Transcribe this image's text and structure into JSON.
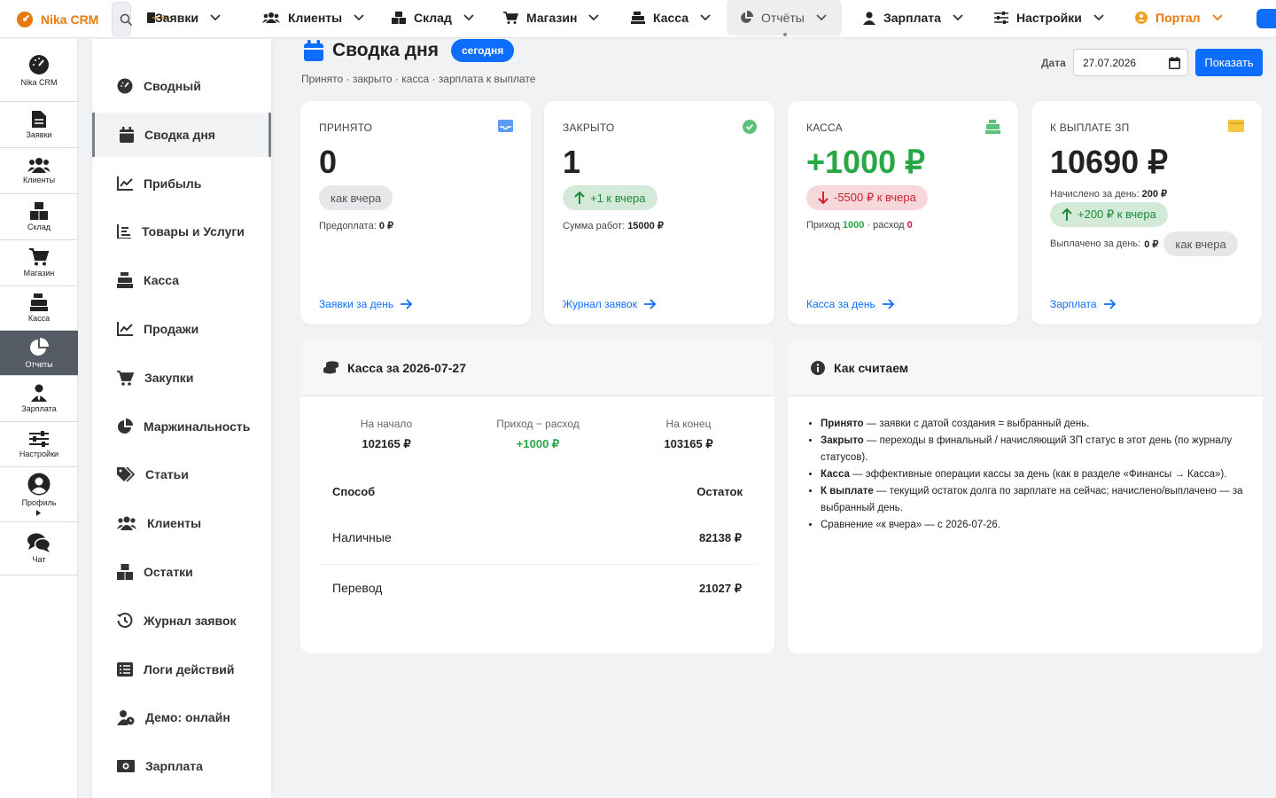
{
  "app": {
    "name": "Nika CRM"
  },
  "topnav": {
    "items": [
      {
        "label": "Заявки",
        "icon": "file-icon"
      },
      {
        "label": "Клиенты",
        "icon": "users-icon"
      },
      {
        "label": "Склад",
        "icon": "boxes-icon"
      },
      {
        "label": "Магазин",
        "icon": "cart-icon"
      },
      {
        "label": "Касса",
        "icon": "cash-register-icon"
      },
      {
        "label": "Отчёты",
        "icon": "pie-chart-icon",
        "active": true
      },
      {
        "label": "Зарплата",
        "icon": "user-icon"
      },
      {
        "label": "Настройки",
        "icon": "sliders-icon"
      },
      {
        "label": "Портал",
        "icon": "portal-icon"
      }
    ]
  },
  "rail": {
    "items": [
      {
        "label": "Nika CRM",
        "icon": "gauge-icon"
      },
      {
        "label": "Заявки",
        "icon": "file-icon"
      },
      {
        "label": "Клиенты",
        "icon": "users-icon"
      },
      {
        "label": "Склад",
        "icon": "boxes-icon"
      },
      {
        "label": "Магазин",
        "icon": "cart-icon"
      },
      {
        "label": "Касса",
        "icon": "cash-register-icon"
      },
      {
        "label": "Отчеты",
        "icon": "pie-chart-icon",
        "active": true
      },
      {
        "label": "Зарплата",
        "icon": "user-tie-icon"
      },
      {
        "label": "Настройки",
        "icon": "sliders-icon"
      },
      {
        "label": "Профиль",
        "icon": "user-circle-icon"
      },
      {
        "label": "Чат",
        "icon": "chat-icon"
      }
    ]
  },
  "submenu": {
    "items": [
      {
        "label": "Сводный",
        "icon": "gauge-icon"
      },
      {
        "label": "Сводка дня",
        "icon": "calendar-icon",
        "active": true
      },
      {
        "label": "Прибыль",
        "icon": "line-chart-icon"
      },
      {
        "label": "Товары и Услуги",
        "icon": "list-icon"
      },
      {
        "label": "Касса",
        "icon": "cash-register-icon"
      },
      {
        "label": "Продажи",
        "icon": "line-chart-icon"
      },
      {
        "label": "Закупки",
        "icon": "cart-icon"
      },
      {
        "label": "Маржинальность",
        "icon": "pie-chart-icon"
      },
      {
        "label": "Статьи",
        "icon": "tags-icon"
      },
      {
        "label": "Клиенты",
        "icon": "users-icon"
      },
      {
        "label": "Остатки",
        "icon": "boxes-icon"
      },
      {
        "label": "Журнал заявок",
        "icon": "history-icon"
      },
      {
        "label": "Логи действий",
        "icon": "list-alt-icon"
      },
      {
        "label": "Демо: онлайн",
        "icon": "user-clock-icon"
      },
      {
        "label": "Зарплата",
        "icon": "money-icon"
      }
    ]
  },
  "header": {
    "title": "Сводка дня",
    "badge": "сегодня",
    "subtitle": "Принято · закрыто · касса · зарплата к выплате",
    "date_label": "Дата",
    "date_value": "27.07.2026",
    "show_button": "Показать"
  },
  "cards": {
    "accepted": {
      "label": "ПРИНЯТО",
      "value": "0",
      "pill": "как вчера",
      "note_prefix": "Предоплата:",
      "note_value": "0 ₽",
      "link": "Заявки за день"
    },
    "closed": {
      "label": "ЗАКРЫТО",
      "value": "1",
      "pill": "+1 к вчера",
      "note_prefix": "Сумма работ:",
      "note_value": "15000 ₽",
      "link": "Журнал заявок"
    },
    "cash": {
      "label": "КАССА",
      "value": "+1000 ₽",
      "pill": "-5500 ₽ к вчера",
      "note_income_label": "Приход",
      "note_income": "1000",
      "note_sep": "· расход",
      "note_expense": "0",
      "link": "Касса за день"
    },
    "payout": {
      "label": "К ВЫПЛАТЕ ЗП",
      "value": "10690 ₽",
      "accrued_label": "Начислено за день:",
      "accrued_value": "200 ₽",
      "pill": "+200 ₽ к вчера",
      "paid_label": "Выплачено за день:",
      "paid_value": "0 ₽",
      "paid_pill": "как вчера",
      "link": "Зарплата"
    }
  },
  "cash_panel": {
    "title": "Касса за 2026-07-27",
    "start_label": "На начало",
    "start_value": "102165 ₽",
    "flow_label": "Приход − расход",
    "flow_value": "+1000 ₽",
    "end_label": "На конец",
    "end_value": "103165 ₽",
    "col_method": "Способ",
    "col_balance": "Остаток",
    "rows": [
      {
        "method": "Наличные",
        "balance": "82138 ₽"
      },
      {
        "method": "Перевод",
        "balance": "21027 ₽"
      }
    ]
  },
  "explain_panel": {
    "title": "Как считаем",
    "items": [
      {
        "term": "Принято",
        "text": " — заявки с датой создания = выбранный день."
      },
      {
        "term": "Закрыто",
        "text": " — переходы в финальный / начисляющий ЗП статус в этот день (по журналу статусов)."
      },
      {
        "term": "Касса",
        "text": " — эффективные операции кассы за день (как в разделе «Финансы → Касса»)."
      },
      {
        "term": "К выплате",
        "text": " — текущий остаток долга по зарплате на сейчас; начислено/выплачено — за выбранный день."
      },
      {
        "term": "",
        "text": "Сравнение «к вчера» — с 2026-07-26."
      }
    ]
  },
  "colors": {
    "accent": "#0d6efd",
    "brand": "#e8790f",
    "positive": "#28a745",
    "negative": "#c82333"
  }
}
